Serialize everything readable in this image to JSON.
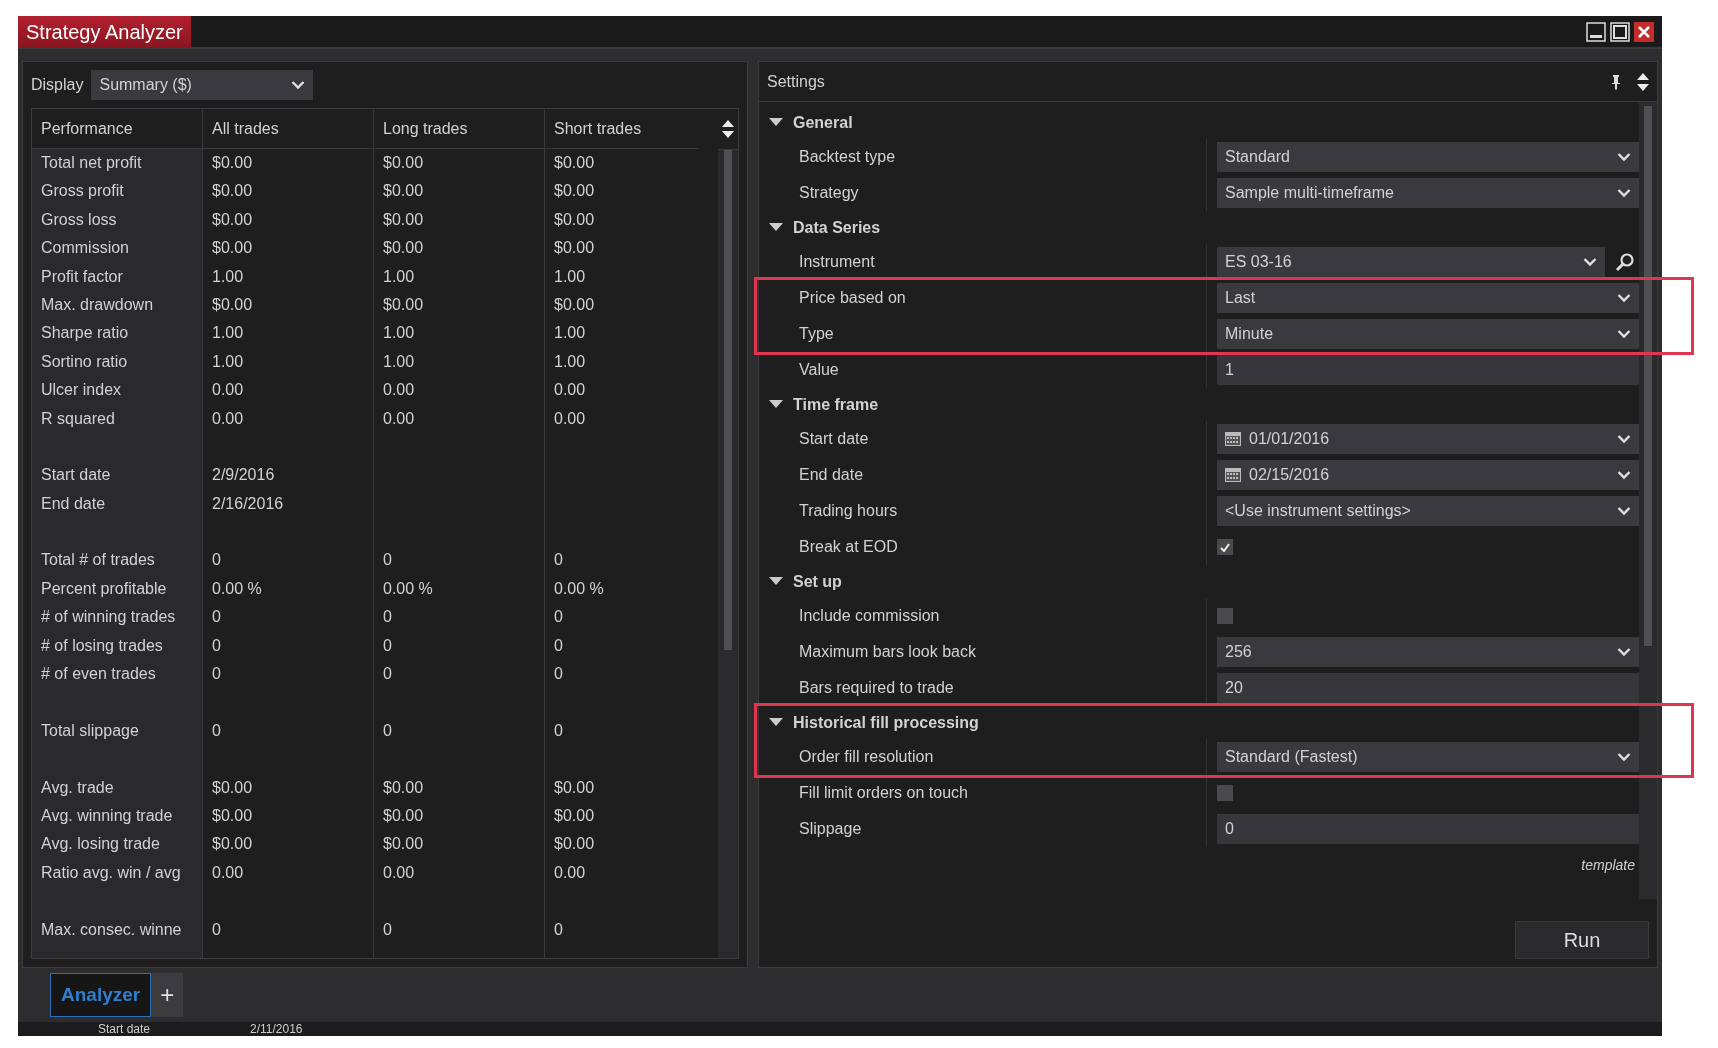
{
  "window": {
    "title": "Strategy Analyzer"
  },
  "display": {
    "label": "Display",
    "value": "Summary ($)"
  },
  "table": {
    "columns": [
      "Performance",
      "All trades",
      "Long trades",
      "Short trades"
    ],
    "row_groups": [
      [
        {
          "cells": [
            "Total net profit",
            "$0.00",
            "$0.00",
            "$0.00"
          ]
        },
        {
          "cells": [
            "Gross profit",
            "$0.00",
            "$0.00",
            "$0.00"
          ]
        },
        {
          "cells": [
            "Gross loss",
            "$0.00",
            "$0.00",
            "$0.00"
          ]
        },
        {
          "cells": [
            "Commission",
            "$0.00",
            "$0.00",
            "$0.00"
          ]
        },
        {
          "cells": [
            "Profit factor",
            "1.00",
            "1.00",
            "1.00"
          ]
        },
        {
          "cells": [
            "Max. drawdown",
            "$0.00",
            "$0.00",
            "$0.00"
          ]
        },
        {
          "cells": [
            "Sharpe ratio",
            "1.00",
            "1.00",
            "1.00"
          ]
        },
        {
          "cells": [
            "Sortino ratio",
            "1.00",
            "1.00",
            "1.00"
          ]
        },
        {
          "cells": [
            "Ulcer index",
            "0.00",
            "0.00",
            "0.00"
          ]
        },
        {
          "cells": [
            "R squared",
            "0.00",
            "0.00",
            "0.00"
          ]
        }
      ],
      [
        {
          "cells": [
            "Start date",
            "2/9/2016"
          ]
        },
        {
          "cells": [
            "End date",
            "2/16/2016"
          ]
        }
      ],
      [
        {
          "cells": [
            "Total # of trades",
            "0",
            "0",
            "0"
          ]
        },
        {
          "cells": [
            "Percent profitable",
            "0.00 %",
            "0.00 %",
            "0.00 %"
          ]
        },
        {
          "cells": [
            "# of winning trades",
            "0",
            "0",
            "0"
          ]
        },
        {
          "cells": [
            "# of losing trades",
            "0",
            "0",
            "0"
          ]
        },
        {
          "cells": [
            "# of even trades",
            "0",
            "0",
            "0"
          ]
        }
      ],
      [
        {
          "cells": [
            "Total slippage",
            "0",
            "0",
            "0"
          ]
        }
      ],
      [
        {
          "cells": [
            "Avg. trade",
            "$0.00",
            "$0.00",
            "$0.00"
          ]
        },
        {
          "cells": [
            "Avg. winning trade",
            "$0.00",
            "$0.00",
            "$0.00"
          ]
        },
        {
          "cells": [
            "Avg. losing trade",
            "$0.00",
            "$0.00",
            "$0.00"
          ]
        },
        {
          "cells": [
            "Ratio avg. win / avg",
            "0.00",
            "0.00",
            "0.00"
          ]
        }
      ],
      [
        {
          "cells": [
            "Max. consec. winne",
            "0",
            "0",
            "0"
          ]
        }
      ]
    ]
  },
  "settings": {
    "title": "Settings",
    "groups": [
      {
        "title": "General",
        "expanded": true,
        "highlighted": false,
        "rows": [
          {
            "label": "Backtest type",
            "kind": "dropdown",
            "value": "Standard",
            "highlighted": false
          },
          {
            "label": "Strategy",
            "kind": "dropdown",
            "value": "Sample multi-timeframe",
            "highlighted": false
          }
        ]
      },
      {
        "title": "Data Series",
        "expanded": true,
        "highlighted": false,
        "rows": [
          {
            "label": "Instrument",
            "kind": "search",
            "value": "ES 03-16",
            "highlighted": false
          },
          {
            "label": "Price based on",
            "kind": "dropdown",
            "value": "Last",
            "highlighted": true
          },
          {
            "label": "Type",
            "kind": "dropdown",
            "value": "Minute",
            "highlighted": true
          },
          {
            "label": "Value",
            "kind": "text",
            "value": "1",
            "highlighted": false
          }
        ]
      },
      {
        "title": "Time frame",
        "expanded": true,
        "highlighted": false,
        "rows": [
          {
            "label": "Start date",
            "kind": "date",
            "value": "01/01/2016",
            "highlighted": false
          },
          {
            "label": "End date",
            "kind": "date",
            "value": "02/15/2016",
            "highlighted": false
          },
          {
            "label": "Trading hours",
            "kind": "dropdown",
            "value": "<Use instrument settings>",
            "highlighted": false
          },
          {
            "label": "Break at EOD",
            "kind": "checkbox",
            "checked": true,
            "highlighted": false
          }
        ]
      },
      {
        "title": "Set up",
        "expanded": true,
        "highlighted": false,
        "rows": [
          {
            "label": "Include commission",
            "kind": "checkbox",
            "checked": false,
            "highlighted": false
          },
          {
            "label": "Maximum bars look back",
            "kind": "dropdown",
            "value": "256",
            "highlighted": false
          },
          {
            "label": "Bars required to trade",
            "kind": "text",
            "value": "20",
            "highlighted": false
          }
        ]
      },
      {
        "title": "Historical fill processing",
        "expanded": true,
        "highlighted": true,
        "rows": [
          {
            "label": "Order fill resolution",
            "kind": "dropdown",
            "value": "Standard (Fastest)",
            "highlighted": true
          },
          {
            "label": "Fill limit orders on touch",
            "kind": "checkbox",
            "checked": false,
            "highlighted": false
          },
          {
            "label": "Slippage",
            "kind": "text",
            "value": "0",
            "highlighted": false
          }
        ]
      }
    ],
    "template_link": "template",
    "run_button": "Run"
  },
  "tabs": [
    {
      "label": "Analyzer",
      "selected": true
    }
  ],
  "add_tab_button": "+",
  "background_row": {
    "cells": [
      "Start date",
      "2/11/2016"
    ]
  }
}
